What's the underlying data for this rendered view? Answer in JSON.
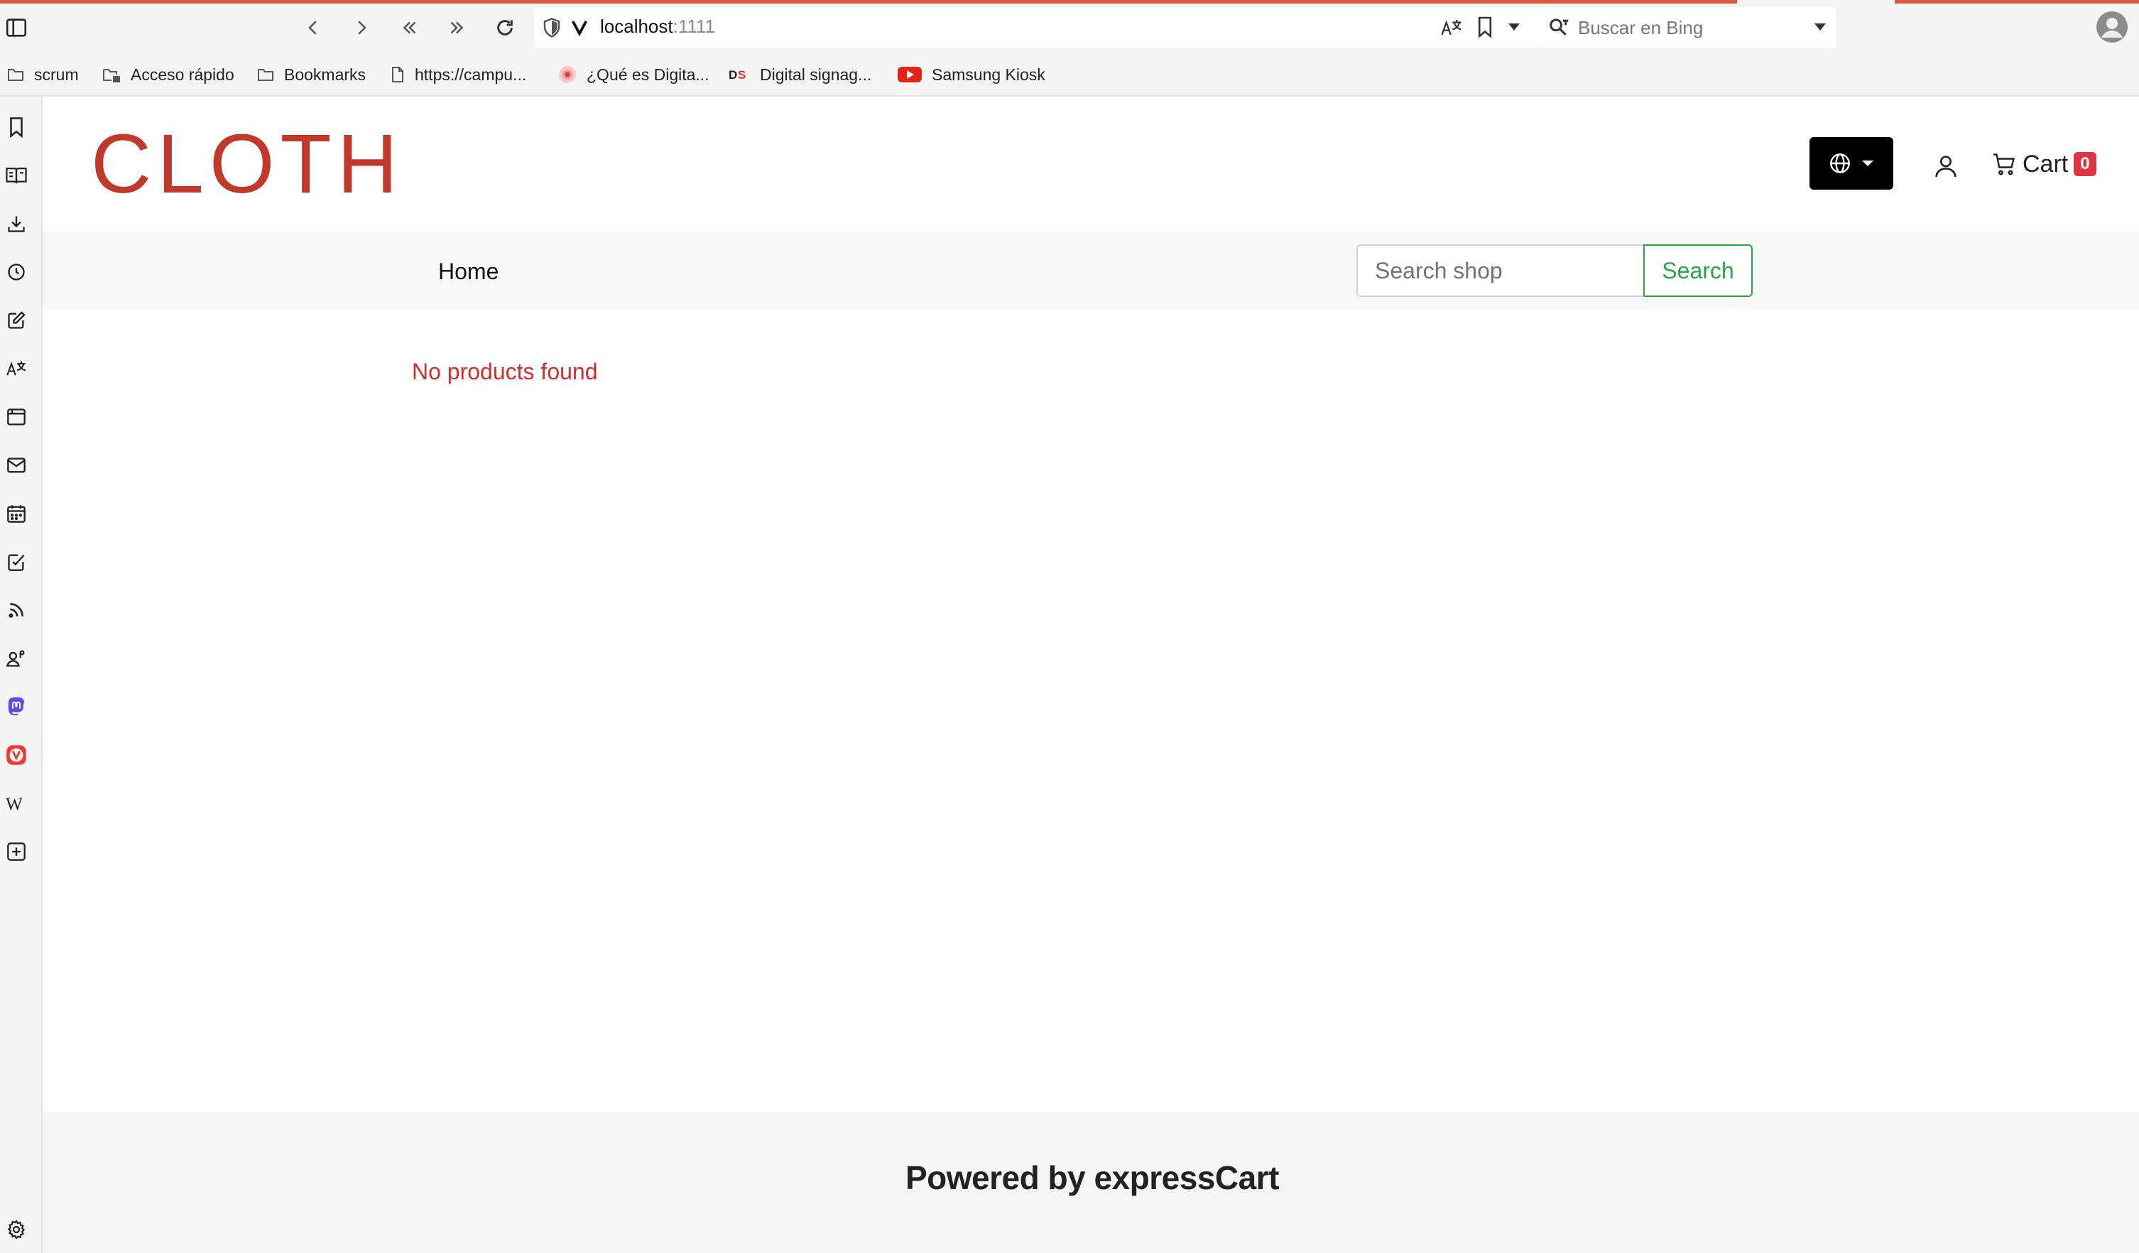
{
  "browser": {
    "url_host": "localhost",
    "url_port": ":1111",
    "search_placeholder": "Buscar en Bing",
    "accent_color": "#e0573f"
  },
  "bookmarks": [
    {
      "label": "scrum",
      "icon": "folder-icon"
    },
    {
      "label": "Acceso rápido",
      "icon": "speed-dial-icon"
    },
    {
      "label": "Bookmarks",
      "icon": "folder-icon"
    },
    {
      "label": "https://campu...",
      "icon": "page-icon"
    },
    {
      "label": "¿Qué es Digita...",
      "icon": "record-icon"
    },
    {
      "label": "Digital signag...",
      "icon": "ds-logo-icon"
    },
    {
      "label": "Samsung Kiosk",
      "icon": "youtube-icon"
    }
  ],
  "sidepanel": {
    "icons": [
      "bookmarks-icon",
      "reading-list-icon",
      "downloads-icon",
      "history-icon",
      "notes-icon",
      "translate-icon",
      "window-icon",
      "mail-icon",
      "calendar-icon",
      "tasks-icon",
      "feeds-icon",
      "contacts-icon",
      "mastodon-icon",
      "vivaldi-icon",
      "wikipedia-icon",
      "add-panel-icon",
      "settings-icon"
    ]
  },
  "shop": {
    "logo": "CLOTH",
    "brand_color": "#c0392b",
    "cart_label": "Cart",
    "cart_count": "0",
    "nav_home": "Home",
    "search_placeholder": "Search shop",
    "search_button": "Search",
    "empty_message": "No products found",
    "footer": "Powered by expressCart"
  }
}
